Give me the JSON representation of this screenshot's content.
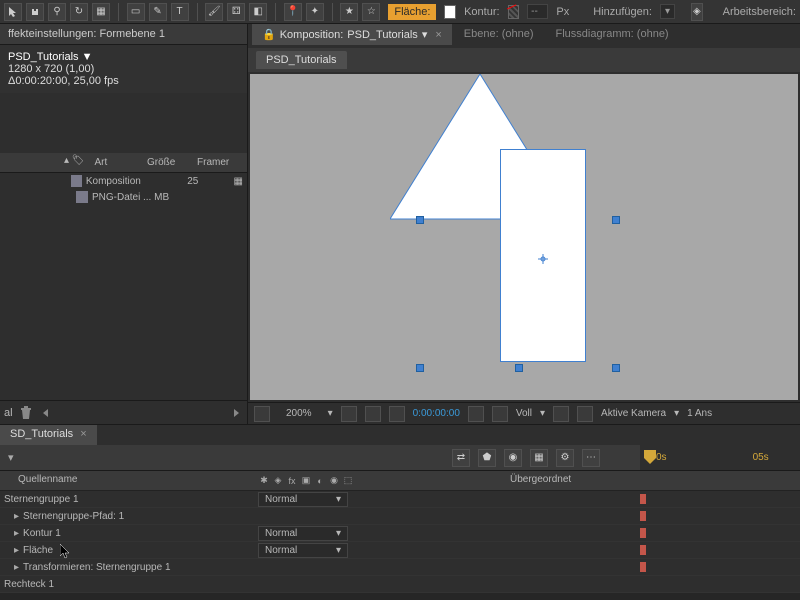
{
  "toolbar": {
    "fill_label": "Fläche:",
    "stroke_label": "Kontur:",
    "px_label": "Px",
    "px_value": "--",
    "add_label": "Hinzufügen:",
    "workspace_label": "Arbeitsbereich:"
  },
  "effects_tab": "ffekteinstellungen: Formebene 1",
  "project": {
    "name": "PSD_Tutorials ▼",
    "resolution": "1280 x 720 (1,00)",
    "duration": "Δ0:00:20:00, 25,00 fps",
    "headers": {
      "art": "Art",
      "groesse": "Größe",
      "framer": "Framer"
    },
    "rows": [
      {
        "art": "Komposition",
        "groesse": "",
        "framer": "25"
      },
      {
        "art": "PNG-Datei",
        "groesse": "... MB",
        "framer": ""
      }
    ],
    "footer_al": "al"
  },
  "comp": {
    "tab_prefix": "Komposition:",
    "tab_name": "PSD_Tutorials",
    "layer_tab": "Ebene: (ohne)",
    "flow_tab": "Flussdiagramm: (ohne)",
    "sub_tab": "PSD_Tutorials",
    "footer": {
      "zoom": "200%",
      "time": "0:00:00:00",
      "voll": "Voll",
      "camera": "Aktive Kamera",
      "ans": "1 Ans"
    }
  },
  "timeline": {
    "tab": "SD_Tutorials",
    "time_0": "0s",
    "time_5": "05s",
    "headers": {
      "source": "Quellenname",
      "parent": "Übergeordnet"
    },
    "mode_normal": "Normal",
    "layers": [
      {
        "name": "Sternengruppe 1",
        "indent": 0,
        "hasMode": true
      },
      {
        "name": "Sternengruppe-Pfad: 1",
        "indent": 1,
        "expand": true
      },
      {
        "name": "Kontur 1",
        "indent": 1,
        "expand": true,
        "hasMode": true
      },
      {
        "name": "Fläche",
        "indent": 1,
        "expand": true,
        "hasMode": true
      },
      {
        "name": "Transformieren: Sternengruppe 1",
        "indent": 1,
        "expand": true
      }
    ],
    "rect_layer": "Rechteck 1"
  }
}
